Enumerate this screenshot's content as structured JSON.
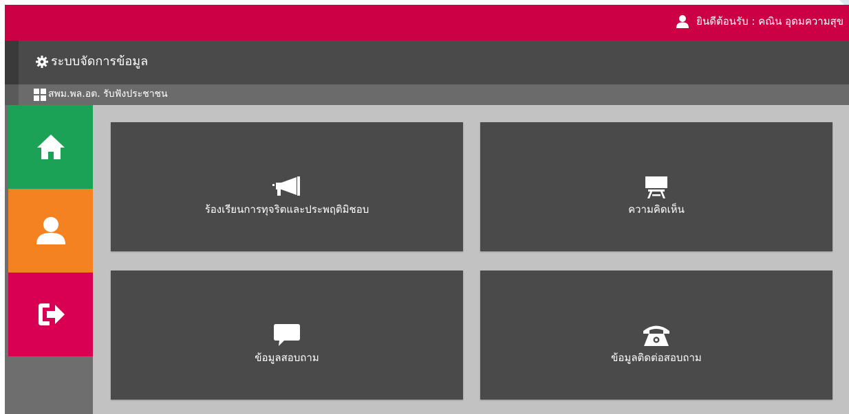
{
  "header": {
    "welcome_text": "ยินดีต้อนรับ : คณิน อุดมความสุข",
    "user_icon": "user-icon",
    "bg_color": "#cc0045"
  },
  "titlebar": {
    "title": "ระบบจัดการข้อมูล",
    "icon": "gear-icon"
  },
  "subbar": {
    "breadcrumb": "สพม.พล.อต. รับฟังประชาชน",
    "icon": "grid-icon"
  },
  "sidebar": {
    "items": [
      {
        "name": "home",
        "icon": "home-icon",
        "color": "#1ba256"
      },
      {
        "name": "profile",
        "icon": "user-icon",
        "color": "#f58220"
      },
      {
        "name": "logout",
        "icon": "logout-icon",
        "color": "#d90054"
      }
    ]
  },
  "tiles": [
    {
      "label": "ร้องเรียนการทุจริตและประพฤติมิชอบ",
      "icon": "megaphone-icon"
    },
    {
      "label": "ความคิดเห็น",
      "icon": "presentation-icon"
    },
    {
      "label": "ข้อมูลสอบถาม",
      "icon": "chat-bubble-icon"
    },
    {
      "label": "ข้อมูลติดต่อสอบถาม",
      "icon": "telephone-icon"
    }
  ]
}
